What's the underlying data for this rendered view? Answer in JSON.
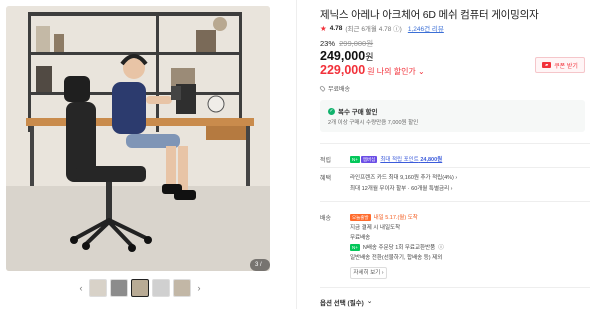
{
  "gallery": {
    "counter": "3 / 13",
    "prev_arrow": "‹",
    "next_arrow": "›",
    "thumbnail_count": 5,
    "active_thumbnail": 3
  },
  "product": {
    "title": "제닉스 아레나 아크체어 6D 메쉬 컴퓨터 게이밍의자",
    "rating": {
      "star": "★",
      "score": "4.78",
      "meta": "(최근 6개월 4.78 ⓘ)",
      "review_link": "1,246건 리뷰"
    },
    "discount_rate": "23%",
    "original_price": "299,000원",
    "price": "249,000",
    "price_unit": "원",
    "my_price": "229,000",
    "my_price_label": "원 나의 할인가 ⌄",
    "coupon_button": "쿠폰 받기",
    "free_shipping": "무료배송"
  },
  "bundle": {
    "title": "복수 구매 할인",
    "desc": "2개 이상 구매시 수량만큼 7,000원 할인"
  },
  "points": {
    "label": "적립",
    "npay": "N+",
    "member": "멤버십",
    "text": "최대 적립 포인트",
    "value": "24,800원"
  },
  "benefits": {
    "label": "혜택",
    "line1": "라인프렌즈 카드 최대 9,160원 추가 적립(4%) ›",
    "line2": "최대 12개월 무이자 할부 · 60개월 특별금리 ›"
  },
  "delivery": {
    "label": "배송",
    "today_badge": "오늘출발",
    "arrival": "내일 5.17.(월) 도착",
    "line2": "지금 결제 시 내일도착",
    "line3": "무료배송",
    "return_text": "N배송 주문당 1회 무료교환반품",
    "return_link": "ⓘ",
    "line5": "일반배송 전환(선물하기, 합배송 등) 제외",
    "see_more": "자세히 보기 ›"
  },
  "options": {
    "label": "옵션 선택 (필수)",
    "chevron": "⌄"
  },
  "colors": {
    "accent_red": "#f2313a",
    "naver_green": "#03c75a",
    "link_blue": "#3b6fd6"
  }
}
